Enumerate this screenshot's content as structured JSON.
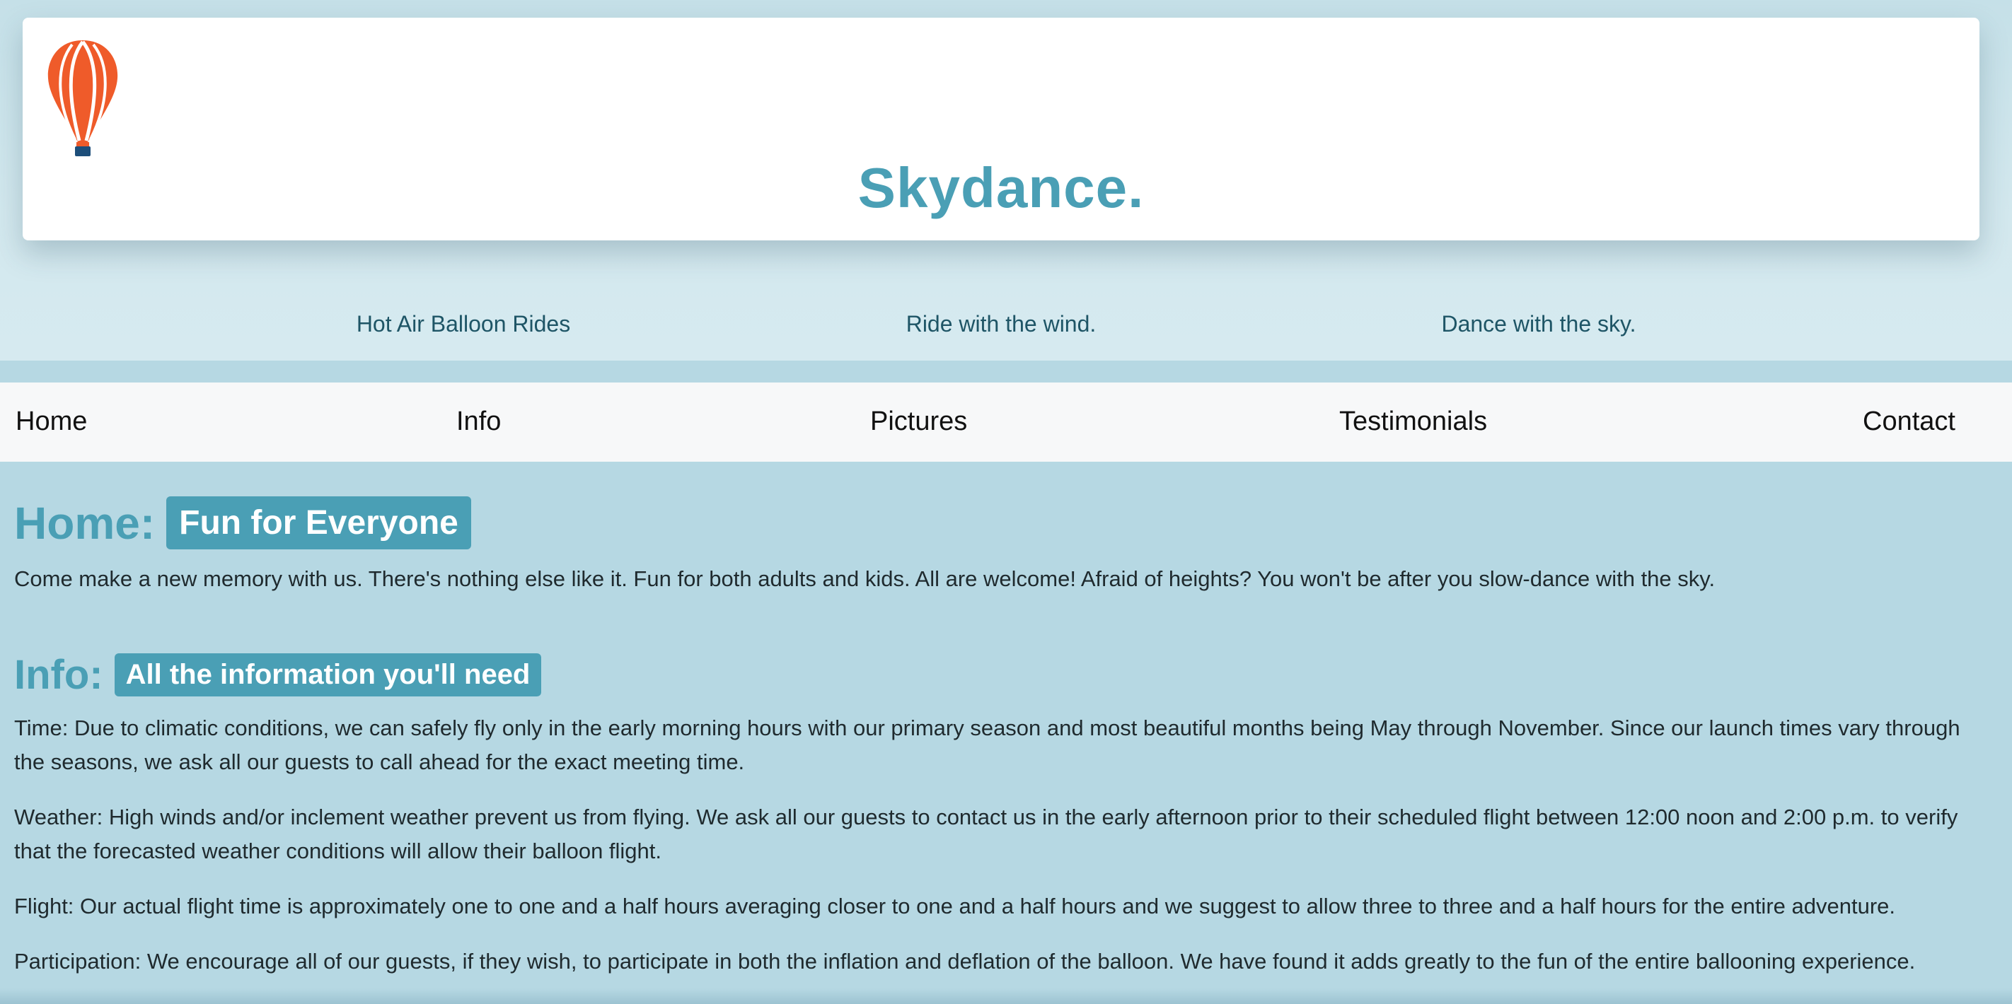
{
  "site": {
    "title": "Skydance.",
    "logo_icon": "hot-air-balloon-icon",
    "accent_color": "#4a9fb5",
    "balloon_color": "#ef5b2a"
  },
  "taglines": [
    "Hot Air Balloon Rides",
    "Ride with the wind.",
    "Dance with the sky."
  ],
  "nav": {
    "items": [
      {
        "label": "Home"
      },
      {
        "label": "Info"
      },
      {
        "label": "Pictures"
      },
      {
        "label": "Testimonials"
      },
      {
        "label": "Contact"
      }
    ]
  },
  "home": {
    "heading": "Home:",
    "badge": "Fun for Everyone",
    "text": "Come make a new memory with us. There's nothing else like it. Fun for both adults and kids. All are welcome! Afraid of heights? You won't be after you slow-dance with the sky."
  },
  "info": {
    "heading": "Info:",
    "badge": "All the information you'll need",
    "paragraphs": [
      "Time: Due to climatic conditions, we can safely fly only in the early morning hours with our primary season and most beautiful months being May through November. Since our launch times vary through the seasons, we ask all our guests to call ahead for the exact meeting time.",
      "Weather: High winds and/or inclement weather prevent us from flying. We ask all our guests to contact us in the early afternoon prior to their scheduled flight between 12:00 noon and 2:00 p.m. to verify that the forecasted weather conditions will allow their balloon flight.",
      "Flight: Our actual flight time is approximately one to one and a half hours averaging closer to one and a half hours and we suggest to allow three to three and a half hours for the entire adventure.",
      "Participation: We encourage all of our guests, if they wish, to participate in both the inflation and deflation of the balloon. We have found it adds greatly to the fun of the entire ballooning experience."
    ]
  }
}
